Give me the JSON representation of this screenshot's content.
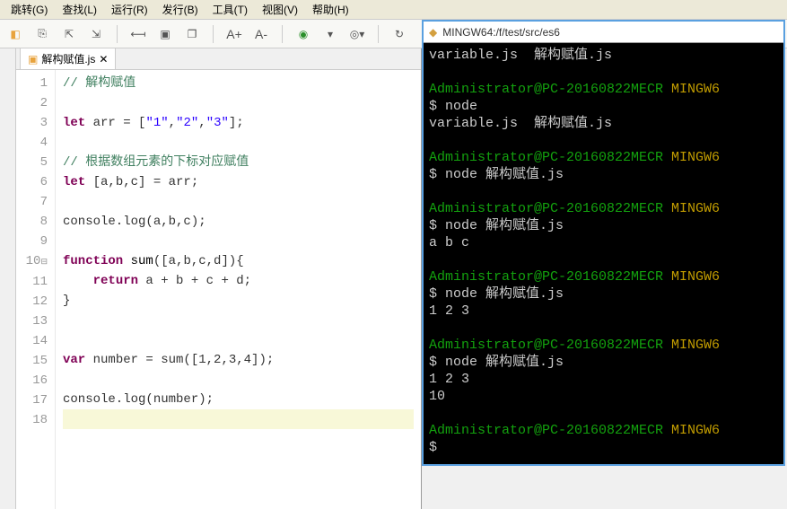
{
  "menu": {
    "items": [
      "跳转(G)",
      "查找(L)",
      "运行(R)",
      "发行(B)",
      "工具(T)",
      "视图(V)",
      "帮助(H)"
    ]
  },
  "toolbar": {
    "icons": [
      "bookmark",
      "new-doc",
      "import",
      "open",
      "nav-back",
      "nav-fwd",
      "save",
      "save-all",
      "font-inc",
      "font-dec",
      "run-green",
      "run-dropdown",
      "cloud-refresh"
    ]
  },
  "tab": {
    "filename": "解构赋值.js",
    "close": "✕"
  },
  "code": {
    "lines": [
      {
        "n": 1,
        "html": "<span class='cm'>// 解构赋值</span>"
      },
      {
        "n": 2,
        "html": ""
      },
      {
        "n": 3,
        "html": "<span class='kw'>let</span> arr = [<span class='st'>\"1\"</span>,<span class='st'>\"2\"</span>,<span class='st'>\"3\"</span>];"
      },
      {
        "n": 4,
        "html": ""
      },
      {
        "n": 5,
        "html": "<span class='cm'>// 根据数组元素的下标对应赋值</span>"
      },
      {
        "n": 6,
        "html": "<span class='kw'>let</span> [a,b,c] = arr;"
      },
      {
        "n": 7,
        "html": ""
      },
      {
        "n": 8,
        "html": "console.log(a,b,c);"
      },
      {
        "n": 9,
        "html": ""
      },
      {
        "n": 10,
        "html": "<span class='kw'>function</span> <span class='fn'>sum</span>([a,b,c,d]){",
        "fold": true
      },
      {
        "n": 11,
        "html": "    <span class='kw'>return</span> a + b + c + d;"
      },
      {
        "n": 12,
        "html": "}"
      },
      {
        "n": 13,
        "html": ""
      },
      {
        "n": 14,
        "html": ""
      },
      {
        "n": 15,
        "html": "<span class='kw'>var</span> number = sum([1,2,3,4]);"
      },
      {
        "n": 16,
        "html": ""
      },
      {
        "n": 17,
        "html": "console.log(number);"
      },
      {
        "n": 18,
        "html": "",
        "current": true
      }
    ]
  },
  "terminal": {
    "title": "MINGW64:/f/test/src/es6",
    "lines": [
      {
        "cls": "w",
        "text": "variable.js  解构赋值.js"
      },
      {
        "cls": "",
        "text": ""
      },
      {
        "cls": "gy",
        "g": "Administrator@PC-20160822MECR",
        "y": " MINGW6"
      },
      {
        "cls": "w",
        "text": "$ node"
      },
      {
        "cls": "w",
        "text": "variable.js  解构赋值.js"
      },
      {
        "cls": "",
        "text": ""
      },
      {
        "cls": "gy",
        "g": "Administrator@PC-20160822MECR",
        "y": " MINGW6"
      },
      {
        "cls": "w",
        "text": "$ node 解构赋值.js"
      },
      {
        "cls": "",
        "text": ""
      },
      {
        "cls": "gy",
        "g": "Administrator@PC-20160822MECR",
        "y": " MINGW6"
      },
      {
        "cls": "w",
        "text": "$ node 解构赋值.js"
      },
      {
        "cls": "w",
        "text": "a b c"
      },
      {
        "cls": "",
        "text": ""
      },
      {
        "cls": "gy",
        "g": "Administrator@PC-20160822MECR",
        "y": " MINGW6"
      },
      {
        "cls": "w",
        "text": "$ node 解构赋值.js"
      },
      {
        "cls": "w",
        "text": "1 2 3"
      },
      {
        "cls": "",
        "text": ""
      },
      {
        "cls": "gy",
        "g": "Administrator@PC-20160822MECR",
        "y": " MINGW6"
      },
      {
        "cls": "w",
        "text": "$ node 解构赋值.js"
      },
      {
        "cls": "w",
        "text": "1 2 3"
      },
      {
        "cls": "w",
        "text": "10"
      },
      {
        "cls": "",
        "text": ""
      },
      {
        "cls": "gy",
        "g": "Administrator@PC-20160822MECR",
        "y": " MINGW6"
      },
      {
        "cls": "w",
        "text": "$"
      }
    ]
  }
}
